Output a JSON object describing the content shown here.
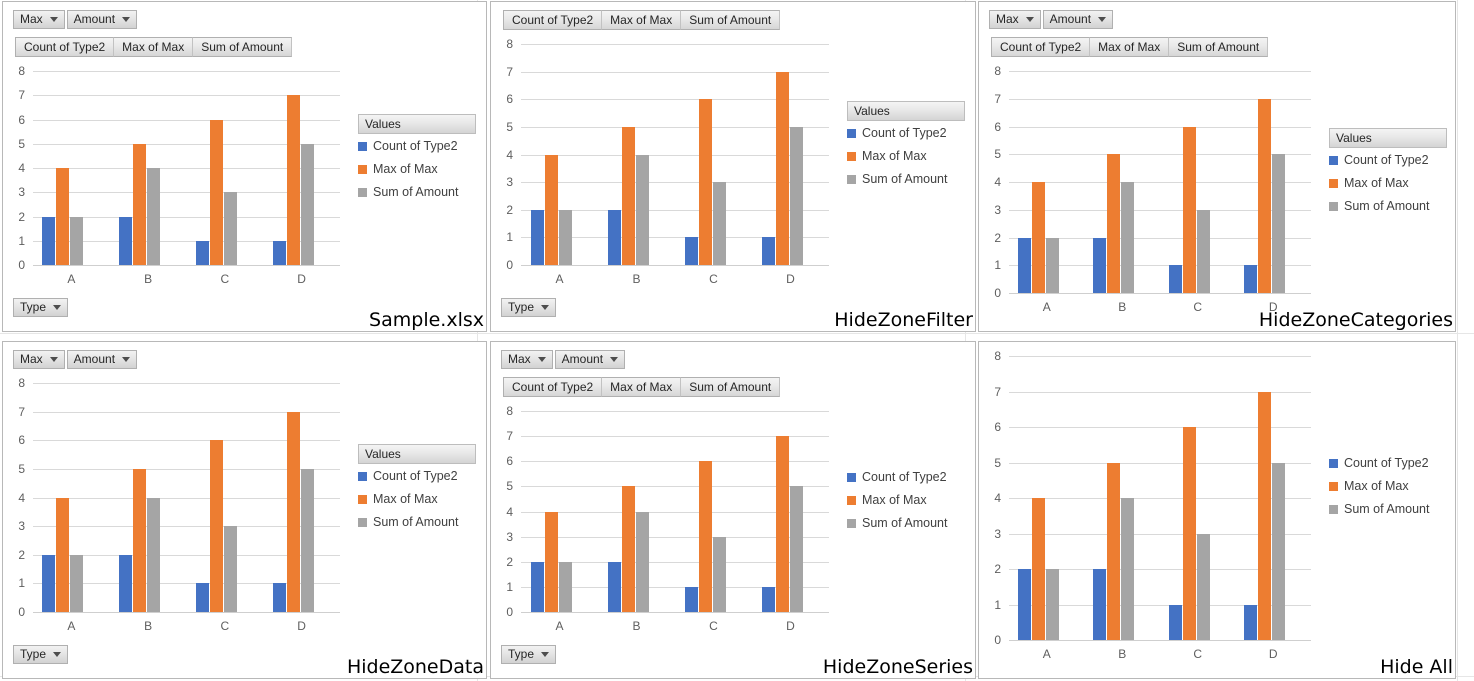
{
  "common": {
    "filter_buttons": [
      {
        "label": "Max",
        "icon": "chevron-down-icon"
      },
      {
        "label": "Amount",
        "icon": "chevron-down-icon"
      }
    ],
    "series_buttons": [
      "Count  of Type2",
      "Max of Max",
      "Sum of Amount"
    ],
    "axis_button": {
      "label": "Type",
      "icon": "chevron-down-icon"
    },
    "legend_title": "Values",
    "colors": {
      "count_of_type2": "#4472C4",
      "max_of_max": "#ED7D31",
      "sum_of_amount": "#A5A5A5",
      "gridline": "#D9D9D9",
      "tick_text": "#5E5E5E"
    }
  },
  "chart_data": {
    "type": "bar",
    "title": "",
    "xlabel": "",
    "ylabel": "",
    "categories": [
      "A",
      "B",
      "C",
      "D"
    ],
    "yticks": [
      "8",
      "7",
      "6",
      "5",
      "4",
      "3",
      "2",
      "1",
      "0"
    ],
    "ylim": [
      0,
      8
    ],
    "grid": true,
    "legend_position": "right",
    "series": [
      {
        "name": "Count of Type2",
        "color": "#4472C4",
        "values": [
          2,
          2,
          1,
          1
        ]
      },
      {
        "name": "Max of Max",
        "color": "#ED7D31",
        "values": [
          4,
          5,
          6,
          7
        ]
      },
      {
        "name": "Sum of Amount",
        "color": "#A5A5A5",
        "values": [
          2,
          4,
          3,
          5
        ]
      }
    ]
  },
  "panels": [
    {
      "id": "sample",
      "caption": "Sample.xlsx",
      "show_filter_buttons": true,
      "show_series_buttons": true,
      "show_axis_button": true,
      "show_legend_title": true
    },
    {
      "id": "hide-zone-filter",
      "caption": "HideZoneFilter",
      "show_filter_buttons": false,
      "show_series_buttons": true,
      "show_axis_button": true,
      "show_legend_title": true
    },
    {
      "id": "hide-zone-categories",
      "caption": "HideZoneCategories",
      "show_filter_buttons": true,
      "show_series_buttons": true,
      "show_axis_button": false,
      "show_legend_title": true
    },
    {
      "id": "hide-zone-data",
      "caption": "HideZoneData",
      "show_filter_buttons": true,
      "show_series_buttons": false,
      "show_axis_button": true,
      "show_legend_title": true
    },
    {
      "id": "hide-zone-series",
      "caption": "HideZoneSeries",
      "show_filter_buttons": true,
      "show_series_buttons": true,
      "show_axis_button": true,
      "show_legend_title": false
    },
    {
      "id": "hide-all",
      "caption": "Hide All",
      "show_filter_buttons": false,
      "show_series_buttons": false,
      "show_axis_button": false,
      "show_legend_title": false
    }
  ]
}
